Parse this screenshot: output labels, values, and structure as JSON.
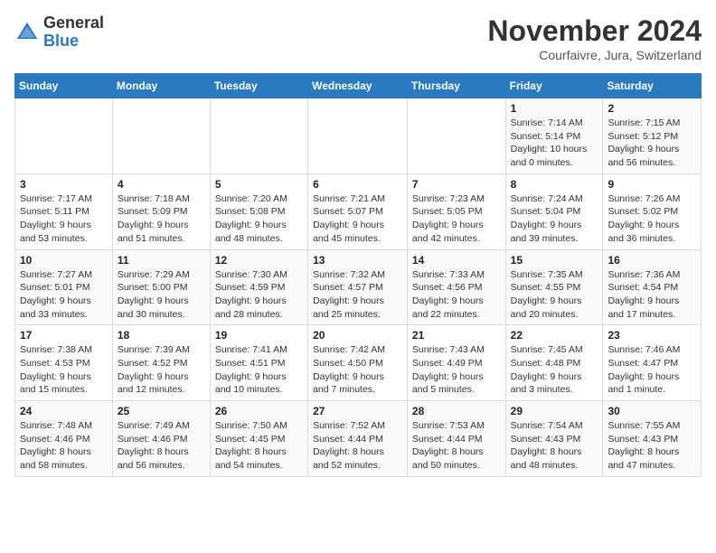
{
  "logo": {
    "general": "General",
    "blue": "Blue"
  },
  "title": "November 2024",
  "location": "Courfaivre, Jura, Switzerland",
  "days_of_week": [
    "Sunday",
    "Monday",
    "Tuesday",
    "Wednesday",
    "Thursday",
    "Friday",
    "Saturday"
  ],
  "weeks": [
    [
      {
        "day": "",
        "info": ""
      },
      {
        "day": "",
        "info": ""
      },
      {
        "day": "",
        "info": ""
      },
      {
        "day": "",
        "info": ""
      },
      {
        "day": "",
        "info": ""
      },
      {
        "day": "1",
        "info": "Sunrise: 7:14 AM\nSunset: 5:14 PM\nDaylight: 10 hours and 0 minutes."
      },
      {
        "day": "2",
        "info": "Sunrise: 7:15 AM\nSunset: 5:12 PM\nDaylight: 9 hours and 56 minutes."
      }
    ],
    [
      {
        "day": "3",
        "info": "Sunrise: 7:17 AM\nSunset: 5:11 PM\nDaylight: 9 hours and 53 minutes."
      },
      {
        "day": "4",
        "info": "Sunrise: 7:18 AM\nSunset: 5:09 PM\nDaylight: 9 hours and 51 minutes."
      },
      {
        "day": "5",
        "info": "Sunrise: 7:20 AM\nSunset: 5:08 PM\nDaylight: 9 hours and 48 minutes."
      },
      {
        "day": "6",
        "info": "Sunrise: 7:21 AM\nSunset: 5:07 PM\nDaylight: 9 hours and 45 minutes."
      },
      {
        "day": "7",
        "info": "Sunrise: 7:23 AM\nSunset: 5:05 PM\nDaylight: 9 hours and 42 minutes."
      },
      {
        "day": "8",
        "info": "Sunrise: 7:24 AM\nSunset: 5:04 PM\nDaylight: 9 hours and 39 minutes."
      },
      {
        "day": "9",
        "info": "Sunrise: 7:26 AM\nSunset: 5:02 PM\nDaylight: 9 hours and 36 minutes."
      }
    ],
    [
      {
        "day": "10",
        "info": "Sunrise: 7:27 AM\nSunset: 5:01 PM\nDaylight: 9 hours and 33 minutes."
      },
      {
        "day": "11",
        "info": "Sunrise: 7:29 AM\nSunset: 5:00 PM\nDaylight: 9 hours and 30 minutes."
      },
      {
        "day": "12",
        "info": "Sunrise: 7:30 AM\nSunset: 4:59 PM\nDaylight: 9 hours and 28 minutes."
      },
      {
        "day": "13",
        "info": "Sunrise: 7:32 AM\nSunset: 4:57 PM\nDaylight: 9 hours and 25 minutes."
      },
      {
        "day": "14",
        "info": "Sunrise: 7:33 AM\nSunset: 4:56 PM\nDaylight: 9 hours and 22 minutes."
      },
      {
        "day": "15",
        "info": "Sunrise: 7:35 AM\nSunset: 4:55 PM\nDaylight: 9 hours and 20 minutes."
      },
      {
        "day": "16",
        "info": "Sunrise: 7:36 AM\nSunset: 4:54 PM\nDaylight: 9 hours and 17 minutes."
      }
    ],
    [
      {
        "day": "17",
        "info": "Sunrise: 7:38 AM\nSunset: 4:53 PM\nDaylight: 9 hours and 15 minutes."
      },
      {
        "day": "18",
        "info": "Sunrise: 7:39 AM\nSunset: 4:52 PM\nDaylight: 9 hours and 12 minutes."
      },
      {
        "day": "19",
        "info": "Sunrise: 7:41 AM\nSunset: 4:51 PM\nDaylight: 9 hours and 10 minutes."
      },
      {
        "day": "20",
        "info": "Sunrise: 7:42 AM\nSunset: 4:50 PM\nDaylight: 9 hours and 7 minutes."
      },
      {
        "day": "21",
        "info": "Sunrise: 7:43 AM\nSunset: 4:49 PM\nDaylight: 9 hours and 5 minutes."
      },
      {
        "day": "22",
        "info": "Sunrise: 7:45 AM\nSunset: 4:48 PM\nDaylight: 9 hours and 3 minutes."
      },
      {
        "day": "23",
        "info": "Sunrise: 7:46 AM\nSunset: 4:47 PM\nDaylight: 9 hours and 1 minute."
      }
    ],
    [
      {
        "day": "24",
        "info": "Sunrise: 7:48 AM\nSunset: 4:46 PM\nDaylight: 8 hours and 58 minutes."
      },
      {
        "day": "25",
        "info": "Sunrise: 7:49 AM\nSunset: 4:46 PM\nDaylight: 8 hours and 56 minutes."
      },
      {
        "day": "26",
        "info": "Sunrise: 7:50 AM\nSunset: 4:45 PM\nDaylight: 8 hours and 54 minutes."
      },
      {
        "day": "27",
        "info": "Sunrise: 7:52 AM\nSunset: 4:44 PM\nDaylight: 8 hours and 52 minutes."
      },
      {
        "day": "28",
        "info": "Sunrise: 7:53 AM\nSunset: 4:44 PM\nDaylight: 8 hours and 50 minutes."
      },
      {
        "day": "29",
        "info": "Sunrise: 7:54 AM\nSunset: 4:43 PM\nDaylight: 8 hours and 48 minutes."
      },
      {
        "day": "30",
        "info": "Sunrise: 7:55 AM\nSunset: 4:43 PM\nDaylight: 8 hours and 47 minutes."
      }
    ]
  ]
}
